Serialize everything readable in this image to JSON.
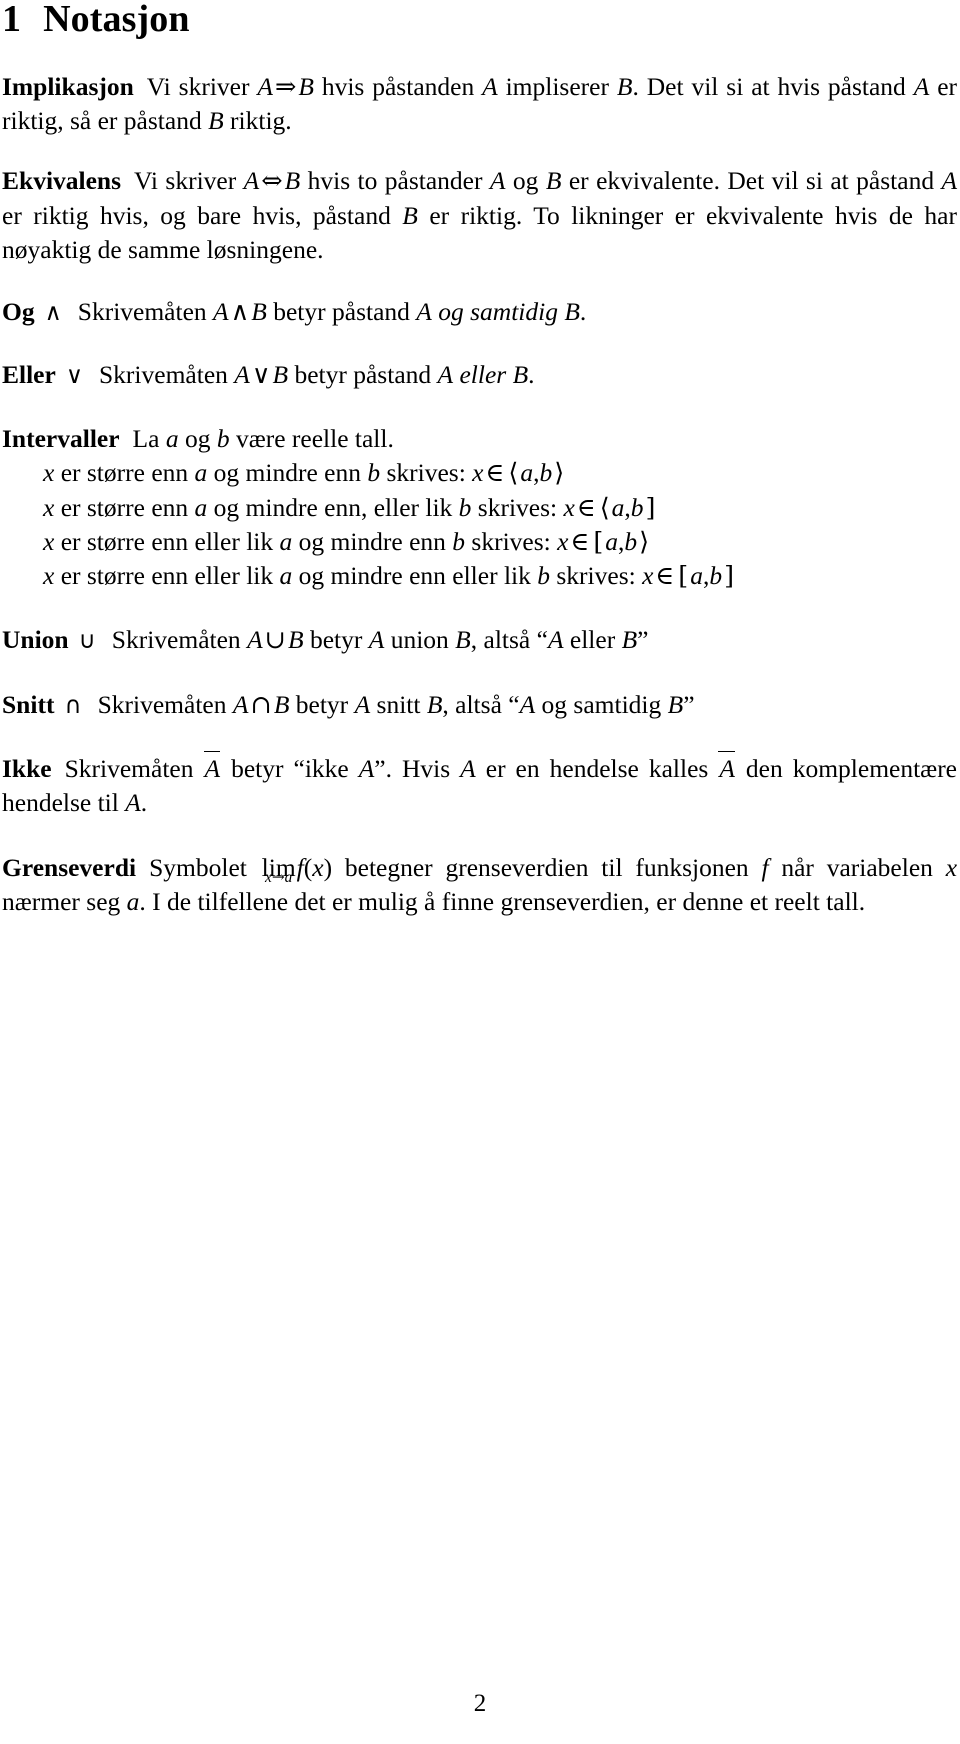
{
  "document": {
    "language": "Norwegian",
    "page_number": "2"
  },
  "heading": {
    "number": "1",
    "title": "Notasjon"
  },
  "symbols": {
    "implies": "⇒",
    "iff": "⇔",
    "and": "∧",
    "or": "∨",
    "union": "∪",
    "intersection": "∩",
    "element_of": "∈",
    "arrow_right": "→",
    "angle_open": "⟨",
    "angle_close": "⟩",
    "bracket_open": "[",
    "bracket_close": "]",
    "quote_open": "“",
    "quote_close": "”"
  },
  "sections": {
    "implikasjon": {
      "term": "Implikasjon",
      "text_1": "Vi skriver",
      "formula_lhs": "A",
      "formula_op": "⇒",
      "formula_rhs": "B",
      "text_2": "hvis påstanden",
      "var_a": "A",
      "text_3": "impliserer",
      "var_b": "B",
      "text_4": ". Det vil si at hvis påstand",
      "var_a2": "A",
      "text_5": "er riktig, så er påstand",
      "var_b2": "B",
      "text_6": "riktig."
    },
    "ekvivalens": {
      "term": "Ekvivalens",
      "text_1": "Vi skriver",
      "formula_lhs": "A",
      "formula_op": "⇔",
      "formula_rhs": "B",
      "text_2": "hvis to påstander",
      "var_a": "A",
      "text_3": "og",
      "var_b": "B",
      "text_4": "er ekvivalente. Det vil si at påstand",
      "var_a2": "A",
      "text_5": "er riktig hvis, og bare hvis, påstand",
      "var_b2": "B",
      "text_6": "er riktig. To likninger er ekvivalente hvis de har nøyaktig de samme løsningene."
    },
    "og": {
      "term": "Og",
      "term_symbol": "∧",
      "text_1": "Skrivemåten",
      "formula_lhs": "A",
      "formula_op": "∧",
      "formula_rhs": "B",
      "text_2": "betyr påstand",
      "var_a": "A",
      "emphasis": "og samtidig",
      "var_b": "B",
      "text_3": "."
    },
    "eller": {
      "term": "Eller",
      "term_symbol": "∨",
      "text_1": "Skrivemåten",
      "formula_lhs": "A",
      "formula_op": "∨",
      "formula_rhs": "B",
      "text_2": "betyr påstand",
      "var_a": "A",
      "emphasis": "eller",
      "var_b": "B",
      "text_3": "."
    },
    "intervaller": {
      "term": "Intervaller",
      "lead_1": "La",
      "lead_var_a": "a",
      "lead_2": "og",
      "lead_var_b": "b",
      "lead_3": "være reelle tall.",
      "items": [
        {
          "var_x": "x",
          "text_1": "er større enn",
          "var_a": "a",
          "text_2": "og mindre enn",
          "var_b": "b",
          "text_3": "skrives:",
          "elem_x": "x",
          "elem_op": "∈",
          "open": "⟨",
          "left": "a",
          "comma": ",",
          "right": "b",
          "close": "⟩"
        },
        {
          "var_x": "x",
          "text_1": "er større enn",
          "var_a": "a",
          "text_2": "og mindre enn, eller lik",
          "var_b": "b",
          "text_3": "skrives:",
          "elem_x": "x",
          "elem_op": "∈",
          "open": "⟨",
          "left": "a",
          "comma": ",",
          "right": "b",
          "close": "]"
        },
        {
          "var_x": "x",
          "text_1": "er større enn eller lik",
          "var_a": "a",
          "text_2": "og mindre enn",
          "var_b": "b",
          "text_3": "skrives:",
          "elem_x": "x",
          "elem_op": "∈",
          "open": "[",
          "left": "a",
          "comma": ",",
          "right": "b",
          "close": "⟩"
        },
        {
          "var_x": "x",
          "text_1": "er større enn eller lik",
          "var_a": "a",
          "text_2": "og mindre enn eller lik",
          "var_b": "b",
          "text_3": "skrives:",
          "elem_x": "x",
          "elem_op": "∈",
          "open": "[",
          "left": "a",
          "comma": ",",
          "right": "b",
          "close": "]"
        }
      ]
    },
    "union": {
      "term": "Union",
      "term_symbol": "∪",
      "text_1": "Skrivemåten",
      "formula_lhs": "A",
      "formula_op": "∪",
      "formula_rhs": "B",
      "text_2": "betyr",
      "var_a": "A",
      "text_3": "union",
      "var_b": "B",
      "text_4": ", altså",
      "quoted_open": "“",
      "quoted_a": "A",
      "quoted_mid": "eller",
      "quoted_b": "B",
      "quoted_close": "”"
    },
    "snitt": {
      "term": "Snitt",
      "term_symbol": "∩",
      "text_1": "Skrivemåten",
      "formula_lhs": "A",
      "formula_op": "∩",
      "formula_rhs": "B",
      "text_2": "betyr",
      "var_a": "A",
      "text_3": "snitt",
      "var_b": "B",
      "text_4": ", altså",
      "quoted_open": "“",
      "quoted_a": "A",
      "quoted_mid": "og samtidig",
      "quoted_b": "B",
      "quoted_close": "”"
    },
    "ikke": {
      "term": "Ikke",
      "text_1": "Skrivemåten",
      "complement_1": "A",
      "text_2": "betyr",
      "quote_open": "“",
      "quoted_text": "ikke",
      "quoted_var": "A",
      "quote_close": "”",
      "text_3": ". Hvis",
      "var_a": "A",
      "text_4": "er en hendelse kalles",
      "complement_2": "A",
      "text_5": "den komplementære hendelse til",
      "var_a2": "A",
      "text_6": "."
    },
    "grenseverdi": {
      "term": "Grenseverdi",
      "text_1": "Symbolet",
      "lim_operator": "lim",
      "lim_sub_var": "x",
      "lim_sub_arrow": "→",
      "lim_sub_target": "a",
      "func_name": "f",
      "func_open": "(",
      "func_var": "x",
      "func_close": ")",
      "text_2": "betegner grenseverdien til funksjonen",
      "var_f": "f",
      "text_3": "når variabelen",
      "var_x": "x",
      "text_4": "nærmer seg",
      "var_a": "a",
      "text_5": ". I de tilfellene det er mulig å finne grenseverdien, er denne et reelt tall."
    }
  },
  "footer": {
    "page_number": "2"
  }
}
